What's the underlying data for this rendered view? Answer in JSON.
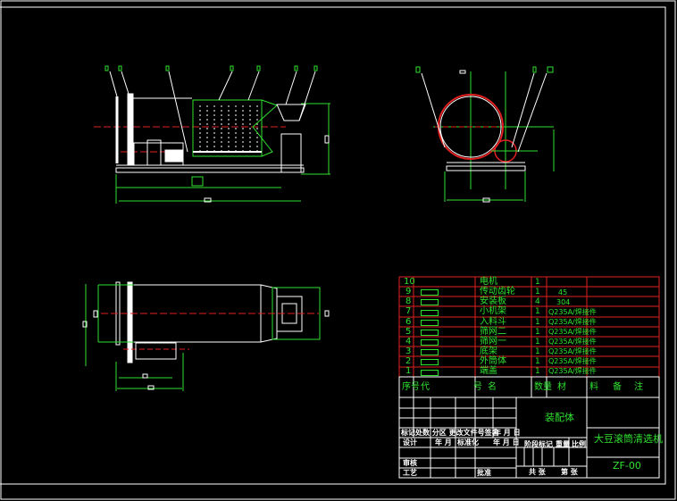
{
  "drawing": {
    "colors": {
      "outline": "#ffffff",
      "dimension": "#2fe02f",
      "centerline": "#e02020",
      "table_line": "#e02020"
    }
  },
  "parts_list": {
    "rows": [
      {
        "seq": "10",
        "name": "电机",
        "qty": "1",
        "material": ""
      },
      {
        "seq": "9",
        "name": "传动齿轮",
        "qty": "1",
        "material": "45"
      },
      {
        "seq": "8",
        "name": "安装板",
        "qty": "4",
        "material": "304"
      },
      {
        "seq": "7",
        "name": "小机架",
        "qty": "1",
        "material": "Q235A/焊接件"
      },
      {
        "seq": "6",
        "name": "入料斗",
        "qty": "1",
        "material": "Q235A/焊接件"
      },
      {
        "seq": "5",
        "name": "筛网二",
        "qty": "1",
        "material": "Q235A/焊接件"
      },
      {
        "seq": "4",
        "name": "筛网一",
        "qty": "1",
        "material": "Q235A/焊接件"
      },
      {
        "seq": "3",
        "name": "底架",
        "qty": "1",
        "material": "Q235A/焊接件"
      },
      {
        "seq": "2",
        "name": "外筒体",
        "qty": "1",
        "material": "Q235A/焊接件"
      },
      {
        "seq": "1",
        "name": "端盖",
        "qty": "1",
        "material": "Q235A/焊接件"
      }
    ],
    "header": {
      "seq": "序号",
      "code": "代",
      "name_a": "号",
      "name_b": "名",
      "qty": "数量",
      "material_a": "材",
      "material_b": "料",
      "note_a": "备",
      "note_b": "注"
    }
  },
  "title_block": {
    "assembly": "装配体",
    "product_name": "大豆滚筒清选机",
    "drawing_no": "ZF-00",
    "row_mark": "标记处数 分区 更改文件号签名",
    "row_mark_date": "年 月 日",
    "design": "设计",
    "design_date": "年 月",
    "standard": "标准化",
    "standard_date": "年 月 日",
    "stage": "阶段标记",
    "weight": "重量",
    "scale": "比例",
    "review": "审核",
    "process": "工艺",
    "approve": "批准",
    "sheets_total": "共 张",
    "sheet_no": "第 张"
  }
}
